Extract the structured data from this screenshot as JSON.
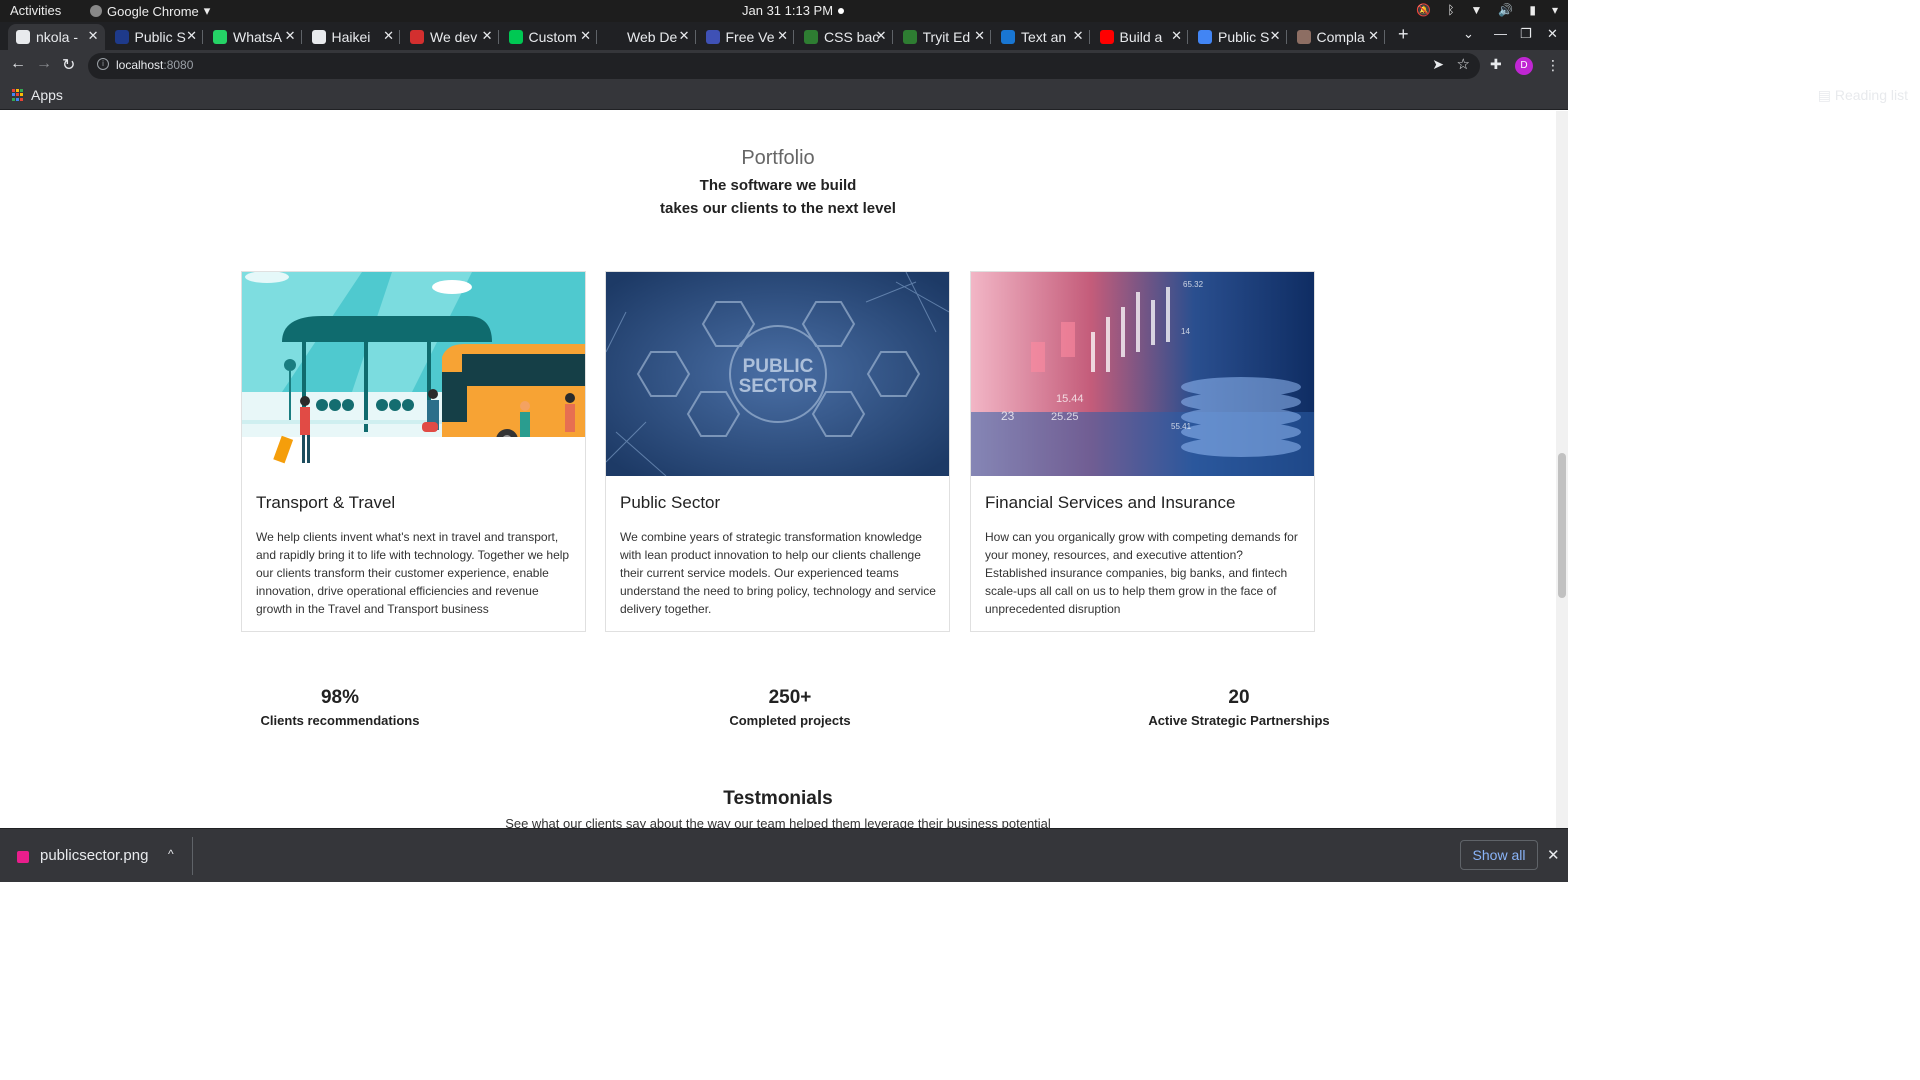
{
  "os": {
    "activities": "Activities",
    "app_name": "Google Chrome",
    "clock": "Jan 31  1:13 PM"
  },
  "tabs": [
    {
      "label": "nkola -",
      "color": "#e8eaed",
      "active": true
    },
    {
      "label": "Public S",
      "color": "#1e3a8a"
    },
    {
      "label": "WhatsA",
      "color": "#25d366"
    },
    {
      "label": "Haikei",
      "color": "#e8eaed"
    },
    {
      "label": "We dev",
      "color": "#d32f2f"
    },
    {
      "label": "Custom",
      "color": "#00c853"
    },
    {
      "label": "Web De",
      "color": "#202124"
    },
    {
      "label": "Free Ve",
      "color": "#3f51b5"
    },
    {
      "label": "CSS bac",
      "color": "#2e7d32"
    },
    {
      "label": "Tryit Ed",
      "color": "#2e7d32"
    },
    {
      "label": "Text an",
      "color": "#1976d2"
    },
    {
      "label": "Build a",
      "color": "#ff0000"
    },
    {
      "label": "Public S",
      "color": "#4285f4"
    },
    {
      "label": "Compla",
      "color": "#8d6e63"
    }
  ],
  "toolbar": {
    "url_host": "localhost",
    "url_port": ":8080",
    "profile_initial": "D"
  },
  "bookmarks": {
    "apps_label": "Apps",
    "reading_list": "Reading list"
  },
  "page": {
    "kicker": "Portfolio",
    "heading_line1": "The software we build",
    "heading_line2": "takes our clients to the next level",
    "cards": [
      {
        "title": "Transport & Travel",
        "body": "We help clients invent what's next in travel and transport, and rapidly bring it to life with technology. Together we help our clients transform their customer experience, enable innovation, drive operational efficiencies and revenue growth in the Travel and Transport business",
        "image": "bus-station-illustration"
      },
      {
        "title": "Public Sector",
        "body": "We combine years of strategic transformation knowledge with lean product innovation to help our clients challenge their current service models. Our experienced teams understand the need to bring policy, technology and service delivery together.",
        "image": "public-sector-hexagons",
        "image_text": "PUBLIC SECTOR"
      },
      {
        "title": "Financial Services and Insurance",
        "body": "How can you organically grow with competing demands for your money, resources, and executive attention? Established insurance companies, big banks, and fintech scale-ups all call on us to help them grow in the face of unprecedented disruption",
        "image": "finance-chart-coins",
        "image_numbers": [
          "65.32",
          "15.44",
          "23",
          "25.25",
          "55.41",
          "14"
        ]
      }
    ],
    "stats": [
      {
        "value": "98%",
        "label": "Clients recommendations"
      },
      {
        "value": "250+",
        "label": "Completed projects"
      },
      {
        "value": "20",
        "label": "Active Strategic Partnerships"
      }
    ],
    "testimonials_title": "Testmonials",
    "testimonials_sub": "See what our clients say about the way our team helped them leverage their business potential"
  },
  "downloads": {
    "file_name": "publicsector.png",
    "show_all": "Show all"
  }
}
